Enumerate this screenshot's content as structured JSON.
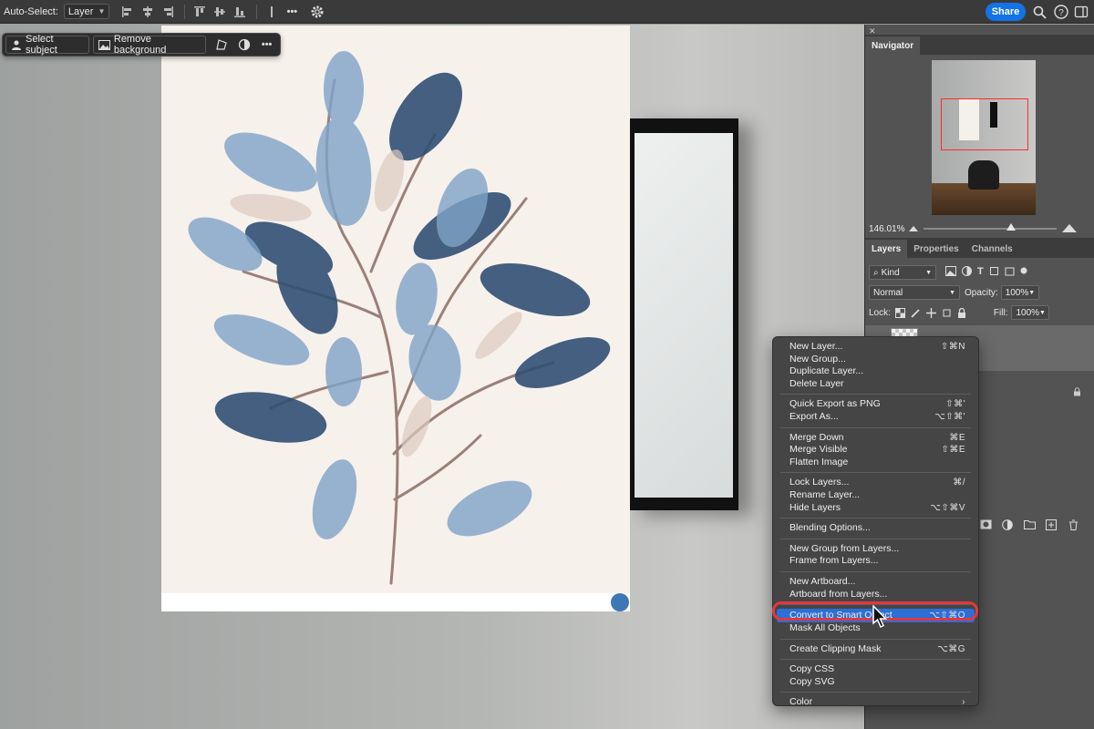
{
  "options_bar": {
    "auto_select_label": "Auto-Select:",
    "auto_select_value": "Layer",
    "more_label": "•••",
    "share_label": "Share"
  },
  "task_bar": {
    "select_subject_label": "Select subject",
    "remove_background_label": "Remove background",
    "more_label": "•••"
  },
  "navigator": {
    "tab_label": "Navigator",
    "zoom_value": "146.01%"
  },
  "layers_panel": {
    "tabs": [
      "Layers",
      "Properties",
      "Channels"
    ],
    "kind_value": "Kind",
    "blend_mode": "Normal",
    "opacity_label": "Opacity:",
    "opacity_value": "100%",
    "lock_label": "Lock:",
    "fill_label": "Fill:",
    "fill_value": "100%"
  },
  "context_menu": {
    "groups": [
      [
        {
          "label": "New Layer...",
          "shortcut": "⇧⌘N"
        },
        {
          "label": "New Group...",
          "shortcut": ""
        },
        {
          "label": "Duplicate Layer...",
          "shortcut": ""
        },
        {
          "label": "Delete Layer",
          "shortcut": ""
        }
      ],
      [
        {
          "label": "Quick Export as PNG",
          "shortcut": "⇧⌘'"
        },
        {
          "label": "Export As...",
          "shortcut": "⌥⇧⌘'"
        }
      ],
      [
        {
          "label": "Merge Down",
          "shortcut": "⌘E"
        },
        {
          "label": "Merge Visible",
          "shortcut": "⇧⌘E"
        },
        {
          "label": "Flatten Image",
          "shortcut": ""
        }
      ],
      [
        {
          "label": "Lock Layers...",
          "shortcut": "⌘/"
        },
        {
          "label": "Rename Layer...",
          "shortcut": ""
        },
        {
          "label": "Hide Layers",
          "shortcut": "⌥⇧⌘V"
        }
      ],
      [
        {
          "label": "Blending Options...",
          "shortcut": ""
        }
      ],
      [
        {
          "label": "New Group from Layers...",
          "shortcut": ""
        },
        {
          "label": "Frame from Layers...",
          "shortcut": ""
        }
      ],
      [
        {
          "label": "New Artboard...",
          "shortcut": ""
        },
        {
          "label": "Artboard from Layers...",
          "shortcut": ""
        }
      ],
      [
        {
          "label": "Convert to Smart Object",
          "shortcut": "⌥⇧⌘O",
          "highlighted": true
        },
        {
          "label": "Mask All Objects",
          "shortcut": ""
        }
      ],
      [
        {
          "label": "Create Clipping Mask",
          "shortcut": "⌥⌘G"
        }
      ],
      [
        {
          "label": "Copy CSS",
          "shortcut": ""
        },
        {
          "label": "Copy SVG",
          "shortcut": ""
        }
      ],
      [
        {
          "label": "Color",
          "shortcut": "›"
        }
      ]
    ]
  },
  "colors": {
    "accent": "#1473e6",
    "menu_highlight": "#2c6fd6",
    "annotation_ring": "#e3383d",
    "leaf_dark": "#2f4f73",
    "leaf_light": "#8fb0cf"
  }
}
